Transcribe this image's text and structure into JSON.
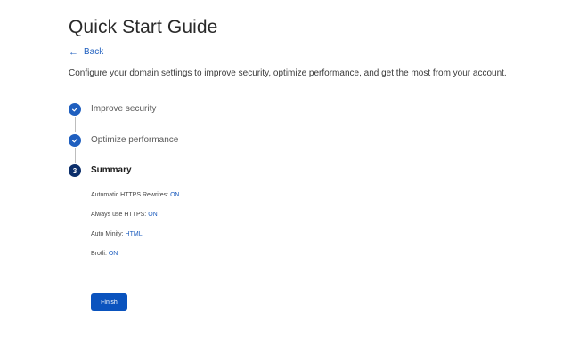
{
  "page": {
    "title": "Quick Start Guide",
    "back_label": "Back",
    "intro": "Configure your domain settings to improve security, optimize performance, and get the most from your account."
  },
  "steps": [
    {
      "label": "Improve security",
      "status": "complete",
      "icon": "check-icon"
    },
    {
      "label": "Optimize performance",
      "status": "complete",
      "icon": "check-icon"
    },
    {
      "label": "Summary",
      "status": "current",
      "number": "3"
    }
  ],
  "summary": [
    {
      "label": "Automatic HTTPS Rewrites:",
      "value": "ON"
    },
    {
      "label": "Always use HTTPS:",
      "value": "ON"
    },
    {
      "label": "Auto Minify:",
      "value": "HTML"
    },
    {
      "label": "Brotli:",
      "value": "ON"
    }
  ],
  "actions": {
    "finish_label": "Finish"
  },
  "colors": {
    "accent": "#1f5fbf",
    "current_step": "#0c2f6b",
    "button": "#0a53be"
  }
}
